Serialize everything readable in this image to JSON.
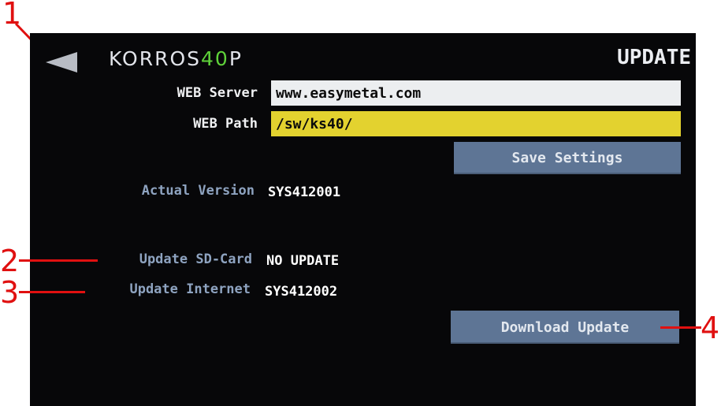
{
  "header": {
    "logo_part1": "KORROS",
    "logo_part2": "40",
    "logo_part3": "P",
    "title": "UPDATE"
  },
  "settings": {
    "web_server_label": "WEB Server",
    "web_server_value": "www.easymetal.com",
    "web_path_label": "WEB Path",
    "web_path_value": "/sw/ks40/",
    "save_button": "Save Settings"
  },
  "versions": {
    "actual_label": "Actual Version",
    "actual_value": "SYS412001",
    "sdcard_label": "Update SD-Card",
    "sdcard_value": "NO UPDATE",
    "internet_label": "Update Internet",
    "internet_value": "SYS412002"
  },
  "download_button": "Download Update",
  "callouts": [
    "1",
    "2",
    "3",
    "4"
  ],
  "colors": {
    "background": "#070709",
    "web_server_field": "#eceef0",
    "web_path_field": "#e3d22f",
    "button": "#5e7595",
    "logo_accent": "#5fd23a",
    "callout": "#e01010"
  }
}
